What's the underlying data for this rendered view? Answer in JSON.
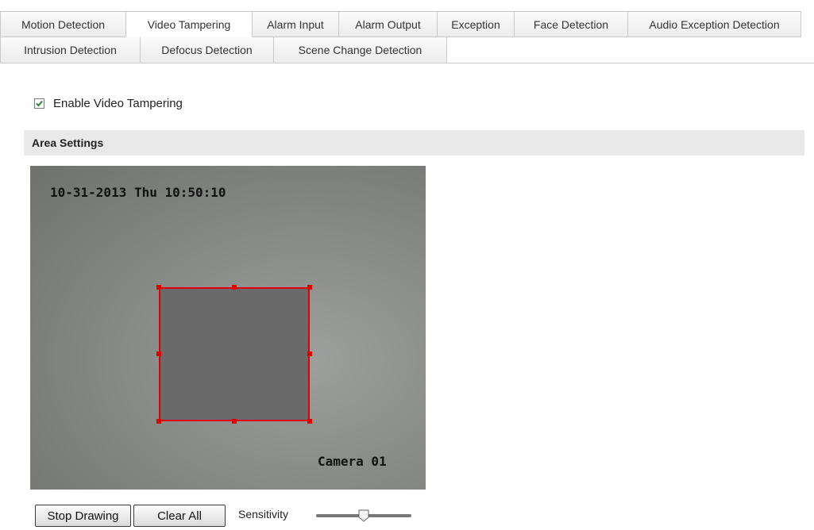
{
  "tabs_row1": [
    {
      "label": "Motion Detection",
      "active": false
    },
    {
      "label": "Video Tampering",
      "active": true
    },
    {
      "label": "Alarm Input",
      "active": false
    },
    {
      "label": "Alarm Output",
      "active": false
    },
    {
      "label": "Exception",
      "active": false
    },
    {
      "label": "Face Detection",
      "active": false
    },
    {
      "label": "Audio Exception Detection",
      "active": false
    }
  ],
  "tabs_row2": [
    {
      "label": "Intrusion Detection",
      "active": false
    },
    {
      "label": "Defocus Detection",
      "active": false
    },
    {
      "label": "Scene Change Detection",
      "active": false
    }
  ],
  "enable": {
    "label": "Enable Video Tampering",
    "checked": true
  },
  "area_settings": {
    "title": "Area Settings"
  },
  "video": {
    "timestamp": "10-31-2013 Thu 10:50:10",
    "camera_name": "Camera 01",
    "region_color": "#e00000"
  },
  "controls": {
    "stop_drawing": "Stop Drawing",
    "clear_all": "Clear All",
    "sensitivity_label": "Sensitivity",
    "sensitivity_fraction": 0.5
  }
}
